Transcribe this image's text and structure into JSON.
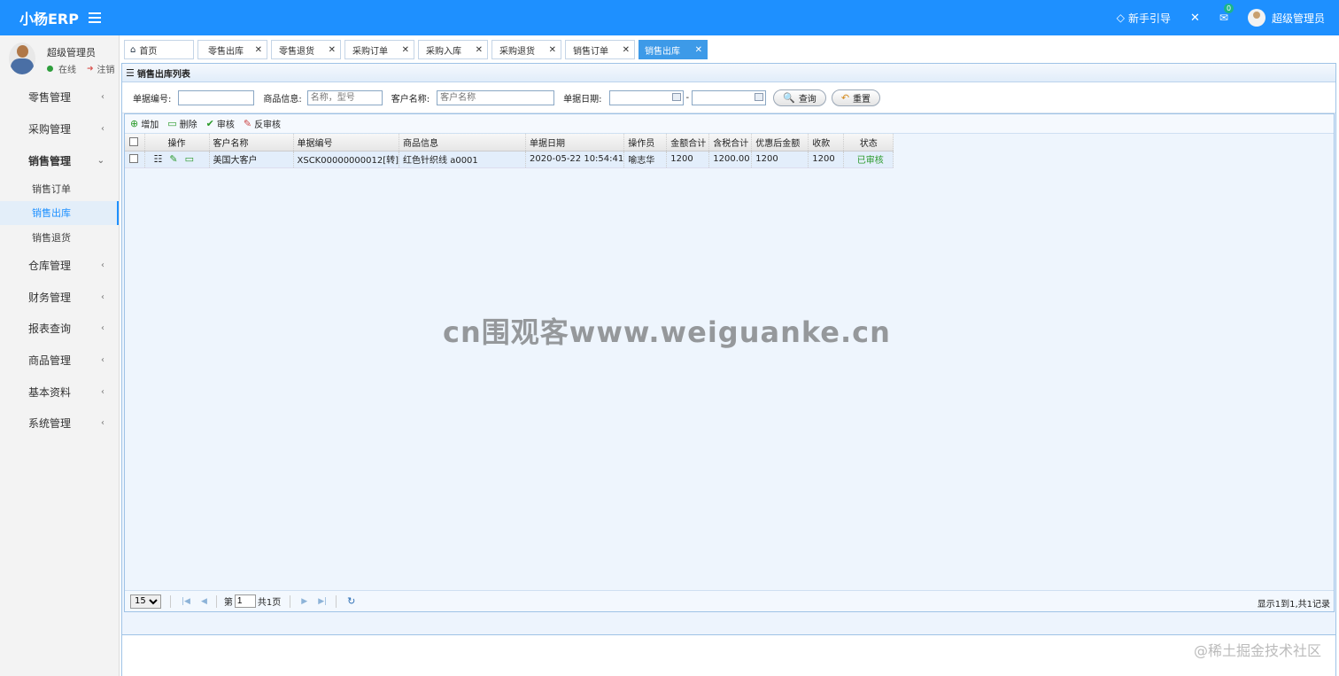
{
  "app": {
    "title": "小杨ERP"
  },
  "header": {
    "guide_label": "新手引导",
    "mail_badge": "0",
    "user_name": "超级管理员"
  },
  "sidebar": {
    "user": {
      "name": "超级管理员",
      "status": "在线",
      "logout": "注销"
    },
    "menu": [
      {
        "label": "零售管理"
      },
      {
        "label": "采购管理"
      },
      {
        "label": "销售管理",
        "open": true,
        "children": [
          {
            "label": "销售订单"
          },
          {
            "label": "销售出库",
            "active": true
          },
          {
            "label": "销售退货"
          }
        ]
      },
      {
        "label": "仓库管理"
      },
      {
        "label": "财务管理"
      },
      {
        "label": "报表查询"
      },
      {
        "label": "商品管理"
      },
      {
        "label": "基本资料"
      },
      {
        "label": "系统管理"
      }
    ]
  },
  "tabs": [
    {
      "label": "首页"
    },
    {
      "label": "零售出库"
    },
    {
      "label": "零售退货"
    },
    {
      "label": "采购订单"
    },
    {
      "label": "采购入库"
    },
    {
      "label": "采购退货"
    },
    {
      "label": "销售订单"
    },
    {
      "label": "销售出库",
      "active": true
    }
  ],
  "panel": {
    "title": "销售出库列表"
  },
  "search": {
    "bill_no_label": "单据编号:",
    "goods_label": "商品信息:",
    "goods_placeholder": "名称，型号",
    "customer_label": "客户名称:",
    "customer_placeholder": "客户名称",
    "date_label": "单据日期:",
    "date_sep": "-",
    "query_button": "查询",
    "reset_button": "重置"
  },
  "toolbar": {
    "add": "增加",
    "delete": "删除",
    "audit": "审核",
    "unaudit": "反审核"
  },
  "table": {
    "columns": [
      "操作",
      "客户名称",
      "单据编号",
      "商品信息",
      "单据日期",
      "操作员",
      "金额合计",
      "含税合计",
      "优惠后金额",
      "收款",
      "状态"
    ],
    "rows": [
      {
        "customer": "美国大客户",
        "bill_no": "XSCK00000000012[转]",
        "goods": "红色针织线 a0001",
        "date": "2020-05-22 10:54:41",
        "operator": "喻志华",
        "amount": "1200",
        "tax_total": "1200.00",
        "discounted": "1200",
        "received": "1200",
        "status": "已审核"
      }
    ]
  },
  "pager": {
    "page_size": "15",
    "page_prefix": "第",
    "page": "1",
    "page_total": "共1页",
    "info": "显示1到1,共1记录"
  },
  "watermarks": {
    "center": "cn围观客www.weiguanke.cn",
    "corner": "@稀土掘金技术社区"
  },
  "colors": {
    "primary": "#1e90ff",
    "status_ok": "#2c9a2c"
  }
}
